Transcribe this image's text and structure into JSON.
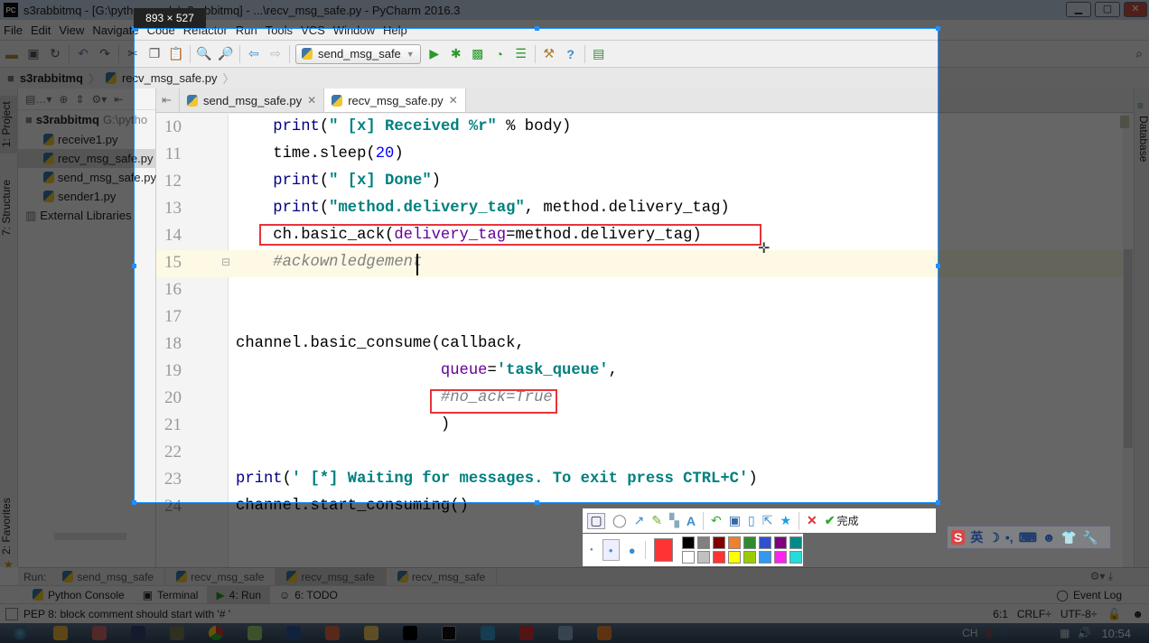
{
  "window": {
    "title": "s3rabbitmq - [G:\\python_code\\s3rabbitmq] - ...\\recv_msg_safe.py - PyCharm 2016.3",
    "app_icon": "PC"
  },
  "menu": [
    "File",
    "Edit",
    "View",
    "Navigate",
    "Code",
    "Refactor",
    "Run",
    "Tools",
    "VCS",
    "Window",
    "Help"
  ],
  "toolbar": {
    "run_config": "send_msg_safe"
  },
  "breadcrumb": {
    "project": "s3rabbitmq",
    "file": "recv_msg_safe.py"
  },
  "side_tabs": {
    "project": "1: Project",
    "structure": "7: Structure",
    "favorites": "2: Favorites",
    "database": "Database"
  },
  "project_tree": {
    "root": "s3rabbitmq",
    "root_path": "G:\\pytho",
    "files": [
      "receive1.py",
      "recv_msg_safe.py",
      "send_msg_safe.py",
      "sender1.py"
    ],
    "selected": "recv_msg_safe.py",
    "external": "External Libraries"
  },
  "editor_tabs": [
    {
      "label": "send_msg_safe.py",
      "active": false
    },
    {
      "label": "recv_msg_safe.py",
      "active": true
    }
  ],
  "code": [
    {
      "n": "10",
      "t": [
        [
          "    ",
          ""
        ],
        [
          "print",
          "kw"
        ],
        [
          "(",
          ""
        ],
        [
          "\" [x] Received %r\"",
          "str"
        ],
        [
          " % body)",
          ""
        ]
      ]
    },
    {
      "n": "11",
      "t": [
        [
          "    time.sleep(",
          ""
        ],
        [
          "20",
          "num"
        ],
        [
          ")",
          ""
        ]
      ]
    },
    {
      "n": "12",
      "t": [
        [
          "    ",
          ""
        ],
        [
          "print",
          "kw"
        ],
        [
          "(",
          ""
        ],
        [
          "\" [x] Done\"",
          "str"
        ],
        [
          ")",
          ""
        ]
      ]
    },
    {
      "n": "13",
      "t": [
        [
          "    ",
          ""
        ],
        [
          "print",
          "kw"
        ],
        [
          "(",
          ""
        ],
        [
          "\"method.delivery_tag\"",
          "str"
        ],
        [
          ", method.delivery_tag)",
          ""
        ]
      ]
    },
    {
      "n": "14",
      "t": [
        [
          "    ch.basic_ack(",
          ""
        ],
        [
          "delivery_tag",
          "kwarg"
        ],
        [
          "=method.delivery_tag)",
          ""
        ]
      ]
    },
    {
      "n": "15",
      "t": [
        [
          "    ",
          ""
        ],
        [
          "#ackownledgement",
          "cm"
        ]
      ]
    },
    {
      "n": "16",
      "t": []
    },
    {
      "n": "17",
      "t": []
    },
    {
      "n": "18",
      "t": [
        [
          "channel.basic_consume(callback,",
          ""
        ]
      ]
    },
    {
      "n": "19",
      "t": [
        [
          "                      ",
          ""
        ],
        [
          "queue",
          "kwarg"
        ],
        [
          "=",
          ""
        ],
        [
          "'task_queue'",
          "str"
        ],
        [
          ",",
          ""
        ]
      ]
    },
    {
      "n": "20",
      "t": [
        [
          "                      ",
          ""
        ],
        [
          "#no_ack=True",
          "cm"
        ]
      ]
    },
    {
      "n": "21",
      "t": [
        [
          "                      )",
          ""
        ]
      ]
    },
    {
      "n": "22",
      "t": []
    },
    {
      "n": "23",
      "t": [
        [
          "print",
          "kw"
        ],
        [
          "(",
          ""
        ],
        [
          "' [*] Waiting for messages. To exit press CTRL+C'",
          "str"
        ],
        [
          ")",
          ""
        ]
      ]
    },
    {
      "n": "24",
      "t": [
        [
          "channel.start_consuming()",
          ""
        ]
      ]
    }
  ],
  "run_bar": {
    "label": "Run:",
    "tabs": [
      {
        "label": "send_msg_safe",
        "active": false
      },
      {
        "label": "recv_msg_safe",
        "active": false
      },
      {
        "label": "recv_msg_safe",
        "active": true
      },
      {
        "label": "recv_msg_safe",
        "active": false
      }
    ]
  },
  "tool_tabs": [
    {
      "label": "Python Console",
      "active": false
    },
    {
      "label": "Terminal",
      "active": false
    },
    {
      "label": "4: Run",
      "active": true
    },
    {
      "label": "6: TODO",
      "active": false
    }
  ],
  "event_log": "Event Log",
  "status": {
    "message": "PEP 8: block comment should start with '# '",
    "position": "6:1",
    "line_sep": "CRLF÷",
    "encoding": "UTF-8÷"
  },
  "taskbar": {
    "lang": "CH",
    "time": "10:54"
  },
  "screenshot_tool": {
    "size_label": "893 × 527",
    "done_label": "完成",
    "selected_color": "#ff3333",
    "palette": [
      "#000000",
      "#808080",
      "#800000",
      "#f08030",
      "#2e8b2e",
      "#3050d0",
      "#800080",
      "#008b8b",
      "#ffffff",
      "#c0c0c0",
      "#ff3333",
      "#ffff00",
      "#99cc00",
      "#3399ee",
      "#ff22ee",
      "#22dddd"
    ]
  },
  "ime": {
    "mode": "英"
  }
}
